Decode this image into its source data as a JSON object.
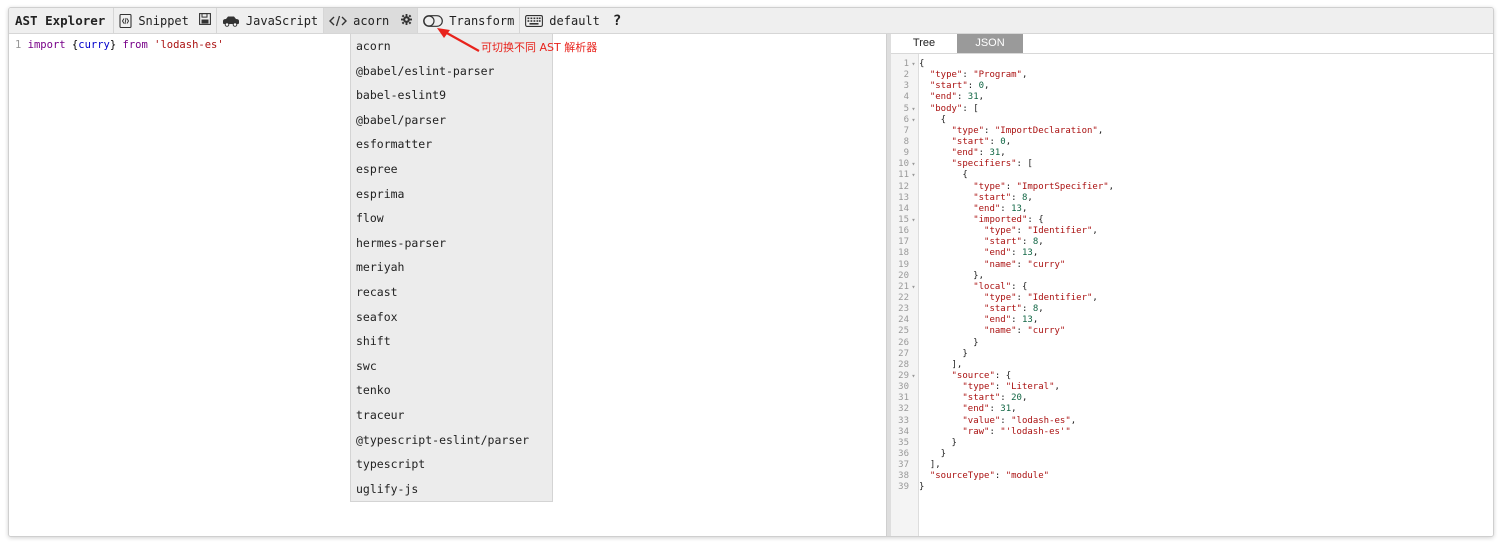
{
  "toolbar": {
    "title": "AST Explorer",
    "snippet": "Snippet",
    "language": "JavaScript",
    "parser": "acorn",
    "transform": "Transform",
    "keymap": "default",
    "help": "?"
  },
  "editor": {
    "line_number": "1",
    "code": {
      "import": "import",
      "open_brace": "{",
      "name": "curry",
      "close_brace": "}",
      "from": "from",
      "source": "'lodash-es'"
    }
  },
  "annotation": "可切换不同 AST 解析器",
  "parser_menu": [
    "acorn",
    "@babel/eslint-parser",
    "babel-eslint9",
    "@babel/parser",
    "esformatter",
    "espree",
    "esprima",
    "flow",
    "hermes-parser",
    "meriyah",
    "recast",
    "seafox",
    "shift",
    "swc",
    "tenko",
    "traceur",
    "@typescript-eslint/parser",
    "typescript",
    "uglify-js"
  ],
  "output": {
    "tabs": [
      "Tree",
      "JSON"
    ],
    "active_tab": "JSON",
    "lines": [
      {
        "n": "1",
        "fold": true,
        "text": "{"
      },
      {
        "n": "2",
        "text": "  \"type\": \"Program\","
      },
      {
        "n": "3",
        "text": "  \"start\": 0,"
      },
      {
        "n": "4",
        "text": "  \"end\": 31,"
      },
      {
        "n": "5",
        "fold": true,
        "text": "  \"body\": ["
      },
      {
        "n": "6",
        "fold": true,
        "text": "    {"
      },
      {
        "n": "7",
        "text": "      \"type\": \"ImportDeclaration\","
      },
      {
        "n": "8",
        "text": "      \"start\": 0,"
      },
      {
        "n": "9",
        "text": "      \"end\": 31,"
      },
      {
        "n": "10",
        "fold": true,
        "text": "      \"specifiers\": ["
      },
      {
        "n": "11",
        "fold": true,
        "text": "        {"
      },
      {
        "n": "12",
        "text": "          \"type\": \"ImportSpecifier\","
      },
      {
        "n": "13",
        "text": "          \"start\": 8,"
      },
      {
        "n": "14",
        "text": "          \"end\": 13,"
      },
      {
        "n": "15",
        "fold": true,
        "text": "          \"imported\": {"
      },
      {
        "n": "16",
        "text": "            \"type\": \"Identifier\","
      },
      {
        "n": "17",
        "text": "            \"start\": 8,"
      },
      {
        "n": "18",
        "text": "            \"end\": 13,"
      },
      {
        "n": "19",
        "text": "            \"name\": \"curry\""
      },
      {
        "n": "20",
        "text": "          },"
      },
      {
        "n": "21",
        "fold": true,
        "text": "          \"local\": {"
      },
      {
        "n": "22",
        "text": "            \"type\": \"Identifier\","
      },
      {
        "n": "23",
        "text": "            \"start\": 8,"
      },
      {
        "n": "24",
        "text": "            \"end\": 13,"
      },
      {
        "n": "25",
        "text": "            \"name\": \"curry\""
      },
      {
        "n": "26",
        "text": "          }"
      },
      {
        "n": "27",
        "text": "        }"
      },
      {
        "n": "28",
        "text": "      ],"
      },
      {
        "n": "29",
        "fold": true,
        "text": "      \"source\": {"
      },
      {
        "n": "30",
        "text": "        \"type\": \"Literal\","
      },
      {
        "n": "31",
        "text": "        \"start\": 20,"
      },
      {
        "n": "32",
        "text": "        \"end\": 31,"
      },
      {
        "n": "33",
        "text": "        \"value\": \"lodash-es\","
      },
      {
        "n": "34",
        "text": "        \"raw\": \"'lodash-es'\""
      },
      {
        "n": "35",
        "text": "      }"
      },
      {
        "n": "36",
        "text": "    }"
      },
      {
        "n": "37",
        "text": "  ],"
      },
      {
        "n": "38",
        "text": "  \"sourceType\": \"module\""
      },
      {
        "n": "39",
        "text": "}"
      }
    ]
  },
  "icons": {
    "snippet": "code-file-icon",
    "save": "save-icon",
    "language": "car-icon",
    "parser": "code-brackets-icon",
    "settings": "gear-icon",
    "transform": "toggle-icon",
    "keymap": "keyboard-icon"
  },
  "colors": {
    "annotation": "#e8231c",
    "active_tab": "#9a9a9a",
    "keyword": "#770088",
    "variable": "#0000cc",
    "string": "#aa1111"
  }
}
